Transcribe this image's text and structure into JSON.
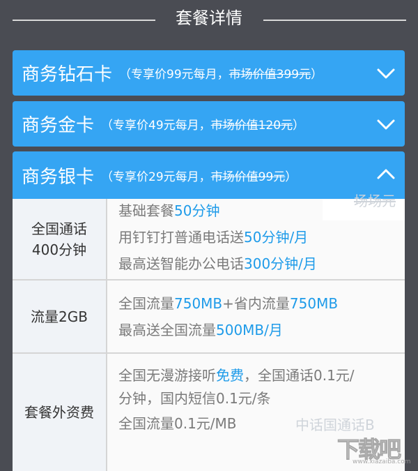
{
  "header": {
    "title": "套餐详情"
  },
  "plans": [
    {
      "name": "商务钻石卡",
      "price_prefix": "（专享价99元每月，",
      "old_price": "市场价值399元",
      "price_suffix": "）",
      "chevron": "chevron-down-icon"
    },
    {
      "name": "商务金卡",
      "price_prefix": "（专享价49元每月，",
      "old_price": "市场价值120元",
      "price_suffix": "）",
      "chevron": "chevron-down-icon"
    },
    {
      "name": "商务银卡",
      "price_prefix": "（专享价29元每月，",
      "old_price": "市场价值99元",
      "price_suffix": "）",
      "chevron": "chevron-up-icon"
    }
  ],
  "details": {
    "rows": [
      {
        "label": "全国通话400分钟",
        "lines": [
          {
            "text": "基础套餐",
            "highlight": "50分钟",
            "after": ""
          },
          {
            "text": "用钉钉打普通电话送",
            "highlight": "50分钟/月",
            "after": ""
          },
          {
            "text": "最高送智能办公电话",
            "highlight": "300分钟/月",
            "after": ""
          }
        ]
      },
      {
        "label": "流量2GB",
        "lines": [
          {
            "text": "全国流量",
            "highlight": "750MB",
            "after": "+省内流量",
            "highlight2": "750MB"
          },
          {
            "text": "最高送全国流量",
            "highlight": "500MB/月",
            "after": ""
          }
        ]
      },
      {
        "label": "套餐外资费",
        "lines": [
          {
            "text": "全国无漫游接听",
            "highlight": "免费",
            "after": "，全国通话0.1元/"
          },
          {
            "text": "分钟，国内短信0.1元/条",
            "highlight": "",
            "after": ""
          },
          {
            "text": "全国流量0.1元/MB",
            "highlight": "",
            "after": ""
          }
        ]
      }
    ],
    "ghost_top": "场场元",
    "ghost_bottom": "中话国通话B"
  },
  "watermark": {
    "main": "下载吧",
    "sub": "www.xiazaiba.com"
  },
  "colors": {
    "background": "#4a4c53",
    "card": "#35a5f3",
    "highlight": "#1e9be9"
  }
}
